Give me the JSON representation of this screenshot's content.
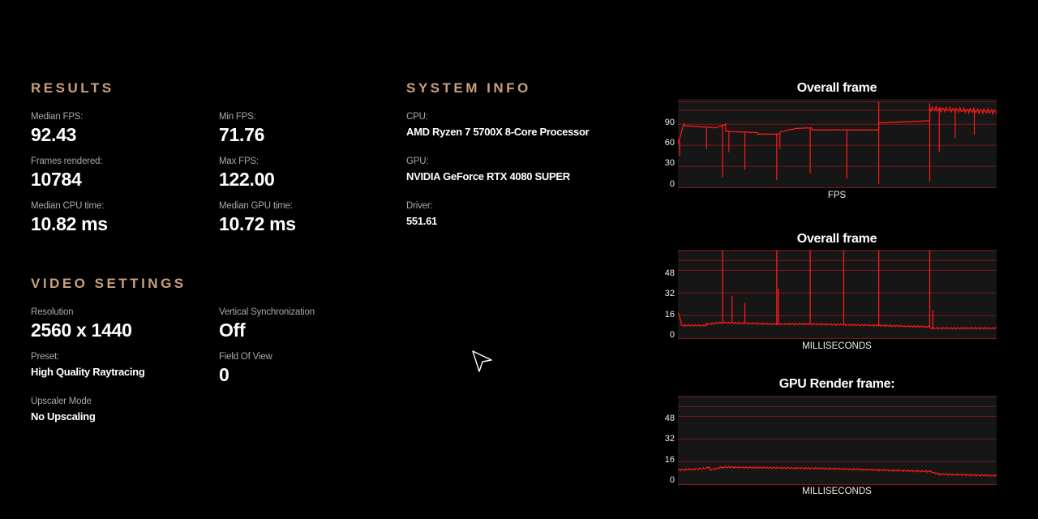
{
  "results": {
    "title": "RESULTS",
    "stats": [
      {
        "label": "Median FPS:",
        "value": "92.43"
      },
      {
        "label": "Min FPS:",
        "value": "71.76"
      },
      {
        "label": "Frames rendered:",
        "value": "10784"
      },
      {
        "label": "Max FPS:",
        "value": "122.00"
      },
      {
        "label": "Median CPU time:",
        "value": "10.82 ms"
      },
      {
        "label": "Median GPU time:",
        "value": "10.72 ms"
      }
    ]
  },
  "video_settings": {
    "title": "VIDEO SETTINGS",
    "items": [
      {
        "label": "Resolution",
        "value": "2560 x 1440"
      },
      {
        "label": "Vertical Synchronization",
        "value": "Off"
      },
      {
        "label": "Preset:",
        "value": "High Quality Raytracing"
      },
      {
        "label": "Field Of View",
        "value": "0"
      },
      {
        "label": "Upscaler Mode",
        "value": "No Upscaling"
      }
    ]
  },
  "system_info": {
    "title": "SYSTEM INFO",
    "items": [
      {
        "label": "CPU:",
        "value": "AMD Ryzen 7 5700X 8-Core Processor"
      },
      {
        "label": "GPU:",
        "value": "NVIDIA GeForce RTX 4080 SUPER"
      },
      {
        "label": "Driver:",
        "value": "551.61"
      }
    ]
  },
  "colors": {
    "accent": "#c9a07a",
    "series": "#ff1a1a",
    "grid": "#7a1a1a",
    "plot_bg": "#161616"
  },
  "chart_data": [
    {
      "type": "line",
      "title": "Overall frame",
      "xlabel": "FPS",
      "yticks": [
        0,
        30,
        60,
        90
      ],
      "ylim": [
        0,
        125
      ],
      "gridlines": [
        30,
        60,
        90,
        110,
        122
      ],
      "segments": [
        {
          "x": [
            0,
            2
          ],
          "y": [
            62,
            92
          ]
        },
        {
          "x": [
            2,
            12
          ],
          "y": [
            88,
            85
          ]
        },
        {
          "x": [
            12,
            15
          ],
          "y": [
            85,
            90
          ]
        },
        {
          "x": [
            15,
            25
          ],
          "y": [
            80,
            78
          ]
        },
        {
          "x": [
            25,
            32
          ],
          "y": [
            76,
            76
          ]
        },
        {
          "x": [
            32,
            37
          ],
          "y": [
            79,
            84
          ]
        },
        {
          "x": [
            37,
            42
          ],
          "y": [
            84,
            85
          ]
        },
        {
          "x": [
            42,
            63
          ],
          "y": [
            82,
            82
          ]
        },
        {
          "x": [
            63,
            79
          ],
          "y": [
            92,
            95
          ]
        },
        {
          "x": [
            79,
            100
          ],
          "y": [
            112,
            108
          ]
        }
      ],
      "dips": [
        {
          "x": 0.5,
          "y": 45
        },
        {
          "x": 9,
          "y": 55
        },
        {
          "x": 14,
          "y": 15
        },
        {
          "x": 16,
          "y": 50
        },
        {
          "x": 21,
          "y": 25
        },
        {
          "x": 31,
          "y": 10
        },
        {
          "x": 32,
          "y": 55
        },
        {
          "x": 41.5,
          "y": 20
        },
        {
          "x": 53,
          "y": 12
        },
        {
          "x": 63,
          "y": 5
        },
        {
          "x": 79,
          "y": 8
        },
        {
          "x": 82,
          "y": 50
        },
        {
          "x": 87,
          "y": 70
        },
        {
          "x": 93,
          "y": 75
        }
      ],
      "spikes": [
        {
          "x": 63,
          "y": 122
        },
        {
          "x": 79,
          "y": 120
        }
      ]
    },
    {
      "type": "line",
      "title": "Overall frame",
      "xlabel": "MILLISECONDS",
      "yticks": [
        0,
        16,
        32,
        48
      ],
      "ylim": [
        0,
        62
      ],
      "gridlines": [
        16,
        32,
        48,
        55,
        62
      ],
      "segments": [
        {
          "x": [
            0,
            1
          ],
          "y": [
            18,
            12
          ]
        },
        {
          "x": [
            1,
            9
          ],
          "y": [
            9,
            9
          ]
        },
        {
          "x": [
            9,
            14
          ],
          "y": [
            10,
            11
          ]
        },
        {
          "x": [
            14,
            31
          ],
          "y": [
            11,
            10
          ]
        },
        {
          "x": [
            31,
            42
          ],
          "y": [
            10,
            10
          ]
        },
        {
          "x": [
            42,
            63
          ],
          "y": [
            10,
            9
          ]
        },
        {
          "x": [
            63,
            79
          ],
          "y": [
            9,
            8
          ]
        },
        {
          "x": [
            79,
            100
          ],
          "y": [
            7,
            7
          ]
        }
      ],
      "dips": [],
      "spikes": [
        {
          "x": 14,
          "y": 62
        },
        {
          "x": 17,
          "y": 30
        },
        {
          "x": 21,
          "y": 25
        },
        {
          "x": 31,
          "y": 62
        },
        {
          "x": 31.5,
          "y": 35
        },
        {
          "x": 41.5,
          "y": 62
        },
        {
          "x": 52,
          "y": 62
        },
        {
          "x": 63,
          "y": 62
        },
        {
          "x": 79,
          "y": 62
        },
        {
          "x": 80,
          "y": 20
        }
      ]
    },
    {
      "type": "line",
      "title": "GPU Render frame:",
      "xlabel": "MILLISECONDS",
      "yticks": [
        0,
        16,
        32,
        48
      ],
      "ylim": [
        0,
        62
      ],
      "gridlines": [
        16,
        32,
        48,
        55,
        62
      ],
      "segments": [
        {
          "x": [
            0,
            8
          ],
          "y": [
            10,
            11
          ]
        },
        {
          "x": [
            8,
            10
          ],
          "y": [
            11,
            12
          ]
        },
        {
          "x": [
            10,
            14
          ],
          "y": [
            10,
            12
          ]
        },
        {
          "x": [
            14,
            48
          ],
          "y": [
            12,
            11
          ]
        },
        {
          "x": [
            48,
            63
          ],
          "y": [
            11,
            10
          ]
        },
        {
          "x": [
            63,
            79
          ],
          "y": [
            10,
            9
          ]
        },
        {
          "x": [
            79,
            82
          ],
          "y": [
            9,
            7
          ]
        },
        {
          "x": [
            82,
            100
          ],
          "y": [
            7,
            6
          ]
        }
      ],
      "dips": [],
      "spikes": []
    }
  ]
}
